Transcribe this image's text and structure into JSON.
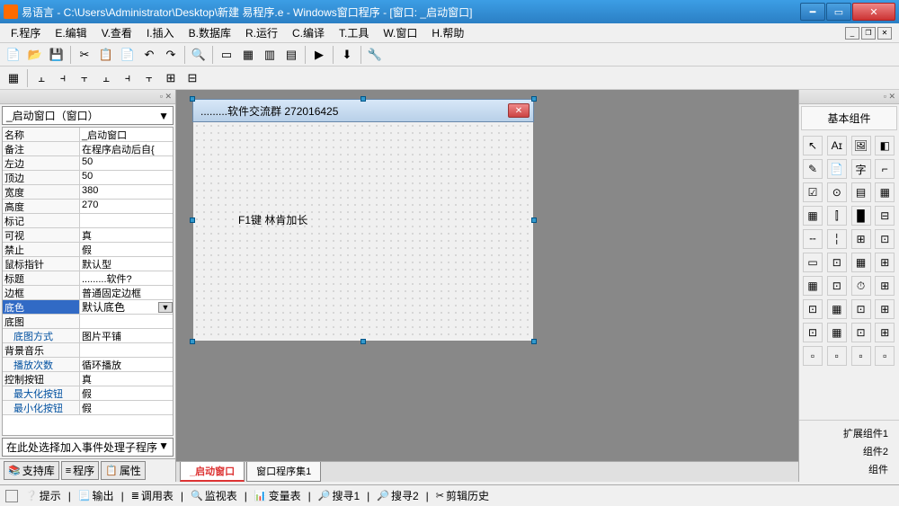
{
  "title": "易语言 - C:\\Users\\Administrator\\Desktop\\新建 易程序.e - Windows窗口程序 - [窗口: _启动窗口]",
  "menu": [
    "F.程序",
    "E.编辑",
    "V.查看",
    "I.插入",
    "B.数据库",
    "R.运行",
    "C.编译",
    "T.工具",
    "W.窗口",
    "H.帮助"
  ],
  "toolbar1_icons": [
    "📄",
    "📂",
    "💾",
    "",
    "✂",
    "📋",
    "📄",
    "↶",
    "↷",
    "",
    "🔍",
    "",
    "▭",
    "▦",
    "▥",
    "▤",
    "",
    "▶",
    "",
    "⬇",
    "",
    "🔧"
  ],
  "toolbar2_icons": [
    "▦",
    "≡",
    "≣",
    "⊞",
    "⊟",
    "⊡",
    "⊠",
    "⊞",
    "⊟",
    "⊡"
  ],
  "left": {
    "combo": "_启动窗口（窗口）",
    "props": [
      {
        "n": "名称",
        "v": "_启动窗口"
      },
      {
        "n": "备注",
        "v": "在程序启动后自{"
      },
      {
        "n": "左边",
        "v": "50"
      },
      {
        "n": "顶边",
        "v": "50"
      },
      {
        "n": "宽度",
        "v": "380"
      },
      {
        "n": "高度",
        "v": "270"
      },
      {
        "n": "标记",
        "v": ""
      },
      {
        "n": "可视",
        "v": "真"
      },
      {
        "n": "禁止",
        "v": "假"
      },
      {
        "n": "鼠标指针",
        "v": "默认型"
      },
      {
        "n": "标题",
        "v": ".........软件?"
      },
      {
        "n": "边框",
        "v": "普通固定边框"
      },
      {
        "n": "底色",
        "v": "默认底色",
        "sel": true
      },
      {
        "n": "底图",
        "v": ""
      },
      {
        "n": "底图方式",
        "v": "图片平铺",
        "indent": true
      },
      {
        "n": "背景音乐",
        "v": ""
      },
      {
        "n": "播放次数",
        "v": "循环播放",
        "indent": true
      },
      {
        "n": "控制按钮",
        "v": "真"
      },
      {
        "n": "最大化按钮",
        "v": "假",
        "indent": true
      },
      {
        "n": "最小化按钮",
        "v": "假",
        "indent": true
      }
    ],
    "event_combo": "在此处选择加入事件处理子程序",
    "tabs": [
      "支持库",
      "程序",
      "属性"
    ]
  },
  "design": {
    "title": ".........软件交流群 272016425",
    "label": "F1键   林肯加长"
  },
  "center_tabs": [
    "_启动窗口",
    "窗口程序集1"
  ],
  "right": {
    "title": "基本组件",
    "ext": [
      "扩展组件1",
      "组件2",
      "组件"
    ]
  },
  "bottom_items": [
    "提示",
    "输出",
    "调用表",
    "监视表",
    "变量表",
    "搜寻1",
    "搜寻2",
    "剪辑历史"
  ]
}
